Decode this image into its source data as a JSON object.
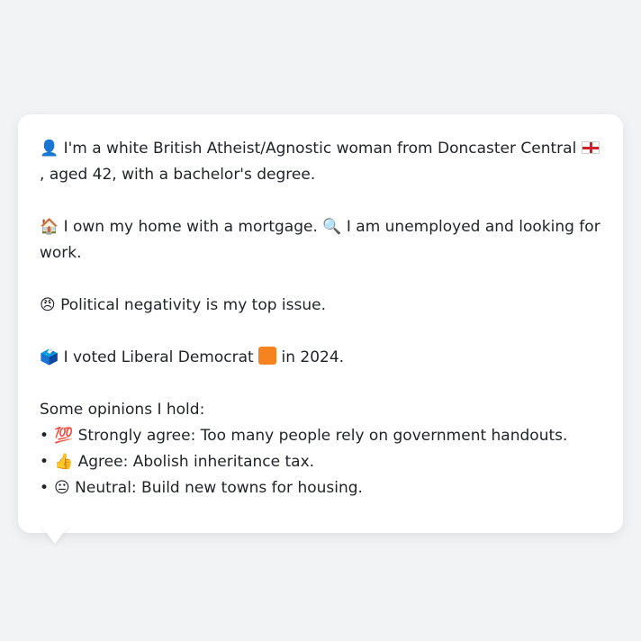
{
  "profile": {
    "p1": {
      "icon": "👤",
      "text_a": "I'm a white British Atheist/Agnostic woman from Doncaster Central",
      "flag": "england-flag",
      "text_b": ",",
      "text_c": "aged 42, with a bachelor's degree."
    },
    "p2": {
      "home_icon": "🏠",
      "home_text": "I own my home with a mortgage.",
      "search_icon": "🔍",
      "search_text": "I am unemployed and looking for work."
    },
    "p3": {
      "icon": "😠",
      "text": "Political negativity is my top issue."
    },
    "p4": {
      "icon": "🗳️",
      "text_a": "I voted Liberal Democrat",
      "party_color": "#f6831f",
      "text_b": "in 2024."
    },
    "opinions": {
      "heading": "Some opinions I hold:",
      "bullet": "•",
      "items": [
        {
          "icon": "💯",
          "text": "Strongly agree: Too many people rely on government handouts."
        },
        {
          "icon": "👍",
          "text": "Agree: Abolish inheritance tax."
        },
        {
          "icon": "😐",
          "text": "Neutral: Build new towns for housing."
        }
      ]
    }
  }
}
